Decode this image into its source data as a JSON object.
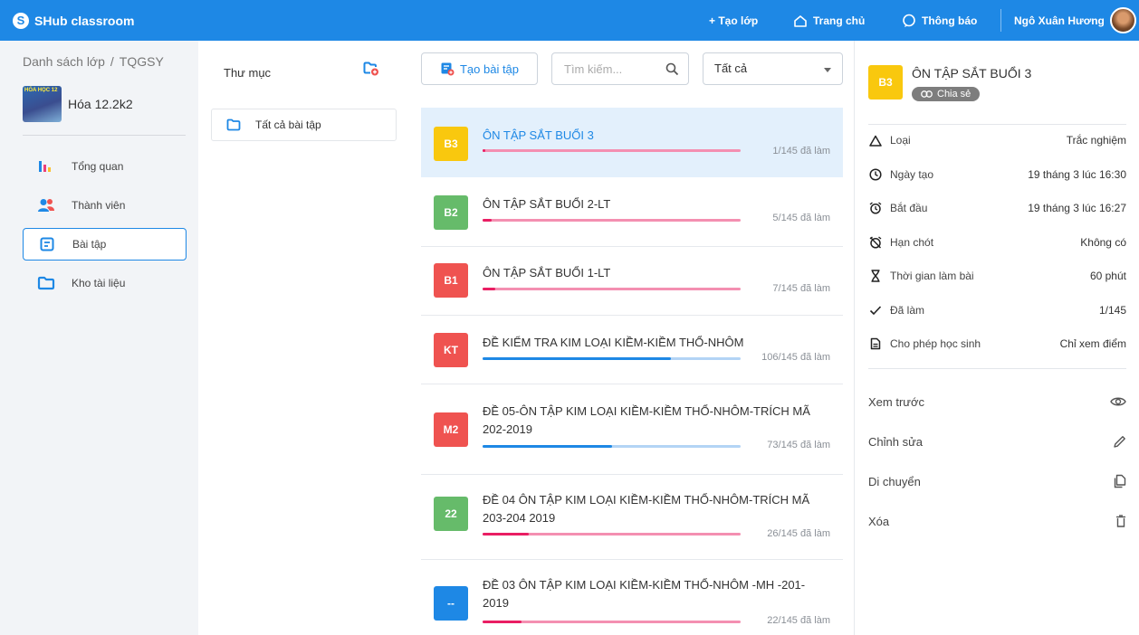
{
  "app": {
    "brand": "SHub classroom"
  },
  "topnav": {
    "create_class": "+ Tạo lớp",
    "home": "Trang chủ",
    "notifications": "Thông báo",
    "user_name": "Ngô Xuân Hương"
  },
  "sidebar": {
    "breadcrumb_root": "Danh sách lớp",
    "breadcrumb_sep": "/",
    "breadcrumb_code": "TQGSY",
    "class_thumb_text": "HÓA HỌC 12",
    "class_name": "Hóa 12.2k2",
    "items": [
      {
        "label": "Tổng quan",
        "icon": "chart-icon"
      },
      {
        "label": "Thành viên",
        "icon": "members-icon"
      },
      {
        "label": "Bài tập",
        "icon": "assignment-icon",
        "active": true
      },
      {
        "label": "Kho tài liệu",
        "icon": "folder-icon"
      }
    ]
  },
  "folders": {
    "title": "Thư mục",
    "items": [
      {
        "label": "Tất cả bài tập"
      }
    ]
  },
  "toolbar": {
    "create_label": "Tạo bài tập",
    "search_placeholder": "Tìm kiếm...",
    "filter_value": "Tất cả"
  },
  "assignments": [
    {
      "badge": "B3",
      "badge_color": "#f9c80e",
      "title": "ÔN TẬP SẮT BUỔI 3",
      "count": "1/145 đã làm",
      "progress": 0.007,
      "track_color": "#f48fb1",
      "fill_color": "#e91e63",
      "selected": true
    },
    {
      "badge": "B2",
      "badge_color": "#66bb6a",
      "title": "ÔN TẬP SẮT BUỔI 2-LT",
      "count": "5/145 đã làm",
      "progress": 0.034,
      "track_color": "#f48fb1",
      "fill_color": "#e91e63"
    },
    {
      "badge": "B1",
      "badge_color": "#ef5350",
      "title": "ÔN TẬP SẮT BUỔI 1-LT",
      "count": "7/145 đã làm",
      "progress": 0.048,
      "track_color": "#f48fb1",
      "fill_color": "#e91e63"
    },
    {
      "badge": "KT",
      "badge_color": "#ef5350",
      "title": "ĐỀ KIỂM TRA KIM LOẠI KIỀM-KIỀM THỔ-NHÔM",
      "count": "106/145 đã làm",
      "progress": 0.731,
      "track_color": "#b3d4f5",
      "fill_color": "#1e88e5"
    },
    {
      "badge": "M2",
      "badge_color": "#ef5350",
      "title": "ĐỀ 05-ÔN TẬP KIM LOẠI KIỀM-KIỀM THỔ-NHÔM-TRÍCH MÃ 202-2019",
      "count": "73/145 đã làm",
      "progress": 0.503,
      "track_color": "#b3d4f5",
      "fill_color": "#1e88e5"
    },
    {
      "badge": "22",
      "badge_color": "#66bb6a",
      "title": "ĐỀ 04 ÔN TẬP KIM LOẠI KIỀM-KIỀM THỔ-NHÔM-TRÍCH MÃ 203-204 2019",
      "count": "26/145 đã làm",
      "progress": 0.179,
      "track_color": "#f48fb1",
      "fill_color": "#e91e63"
    },
    {
      "badge": "--",
      "badge_color": "#1e88e5",
      "title": "ĐỀ 03 ÔN TẬP KIM LOẠI KIỀM-KIỀM THỔ-NHÔM -MH -201-2019",
      "count": "22/145 đã làm",
      "progress": 0.152,
      "track_color": "#f48fb1",
      "fill_color": "#e91e63"
    }
  ],
  "detail": {
    "badge": "B3",
    "title": "ÔN TẬP SẮT BUỔI 3",
    "share_label": "Chia sẻ",
    "rows": [
      {
        "icon": "triangle-icon",
        "label": "Loại",
        "value": "Trắc nghiệm"
      },
      {
        "icon": "clock-icon",
        "label": "Ngày tạo",
        "value": "19 tháng 3 lúc 16:30"
      },
      {
        "icon": "alarm-icon",
        "label": "Bắt đầu",
        "value": "19 tháng 3 lúc 16:27"
      },
      {
        "icon": "alarm-off-icon",
        "label": "Hạn chót",
        "value": "Không có"
      },
      {
        "icon": "hourglass-icon",
        "label": "Thời gian làm bài",
        "value": "60 phút"
      },
      {
        "icon": "check-icon",
        "label": "Đã làm",
        "value": "1/145"
      },
      {
        "icon": "document-icon",
        "label": "Cho phép học sinh",
        "value": "Chỉ xem điểm"
      }
    ],
    "actions": [
      {
        "label": "Xem trước",
        "icon": "eye-icon"
      },
      {
        "label": "Chỉnh sửa",
        "icon": "pencil-icon"
      },
      {
        "label": "Di chuyển",
        "icon": "copy-icon"
      },
      {
        "label": "Xóa",
        "icon": "trash-icon"
      }
    ]
  }
}
